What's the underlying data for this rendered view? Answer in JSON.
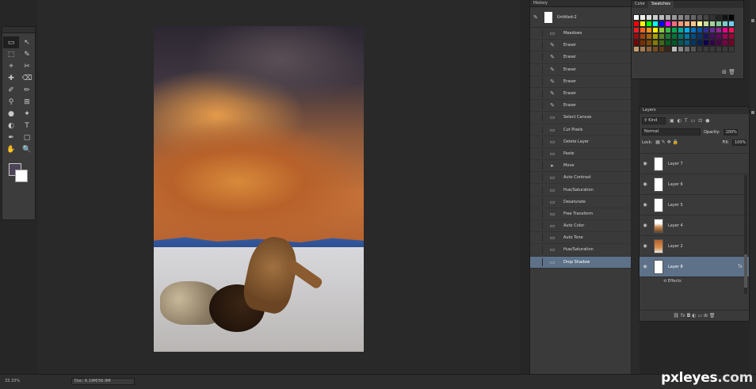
{
  "tools": {
    "items": [
      "▭",
      "↖",
      "⬚",
      "✎",
      "⌖",
      "✂",
      "✚",
      "⌫",
      "✐",
      "✏",
      "⚲",
      "⊞",
      "●",
      "✦",
      "◐",
      "T",
      "✒",
      "▢",
      "✋",
      "🔍"
    ],
    "fg_color": "#4d4458",
    "bg_color": "#ffffff"
  },
  "history": {
    "tab": "History",
    "snapshot": "Untitled-2",
    "items": [
      {
        "label": "Meadows",
        "icon": ""
      },
      {
        "label": "Eraser",
        "icon": "✎"
      },
      {
        "label": "Eraser",
        "icon": "✎"
      },
      {
        "label": "Eraser",
        "icon": "✎"
      },
      {
        "label": "Eraser",
        "icon": "✎"
      },
      {
        "label": "Eraser",
        "icon": "✎"
      },
      {
        "label": "Eraser",
        "icon": "✎"
      },
      {
        "label": "Select Canvas",
        "icon": ""
      },
      {
        "label": "Cut Pixels",
        "icon": ""
      },
      {
        "label": "Delete Layer",
        "icon": ""
      },
      {
        "label": "Paste",
        "icon": ""
      },
      {
        "label": "Move",
        "icon": "▸"
      },
      {
        "label": "Auto Contrast",
        "icon": ""
      },
      {
        "label": "Hue/Saturation",
        "icon": ""
      },
      {
        "label": "Desaturate",
        "icon": ""
      },
      {
        "label": "Free Transform",
        "icon": ""
      },
      {
        "label": "Auto Color",
        "icon": ""
      },
      {
        "label": "Auto Tone",
        "icon": ""
      },
      {
        "label": "Hue/Saturation",
        "icon": ""
      },
      {
        "label": "Drop Shadow",
        "icon": ""
      }
    ]
  },
  "swatches": {
    "tabs": [
      "Color",
      "Swatches"
    ],
    "colors": [
      "#ffffff",
      "#eeeeee",
      "#dddddd",
      "#cccccc",
      "#bbbbbb",
      "#aaaaaa",
      "#999999",
      "#888888",
      "#777777",
      "#666666",
      "#555555",
      "#444444",
      "#333333",
      "#222222",
      "#111111",
      "#000000",
      "#ff0000",
      "#ffff00",
      "#00ff00",
      "#00ffff",
      "#0000ff",
      "#ff00ff",
      "#f26d7d",
      "#f7977a",
      "#fbad82",
      "#fdc68c",
      "#fff79a",
      "#c4df9b",
      "#a3d39c",
      "#82ca9d",
      "#7bcdc8",
      "#6ecff6",
      "#ed1c24",
      "#f26522",
      "#f7941d",
      "#fff200",
      "#8dc63f",
      "#39b54a",
      "#00a651",
      "#00a99d",
      "#00aeef",
      "#0072bc",
      "#0054a6",
      "#2e3192",
      "#662d91",
      "#92278f",
      "#ec008c",
      "#ed145b",
      "#9e0b0f",
      "#a0410d",
      "#a36209",
      "#aba000",
      "#598527",
      "#1a7b30",
      "#007236",
      "#00746b",
      "#0076a3",
      "#004b80",
      "#003471",
      "#1b1464",
      "#440e62",
      "#630460",
      "#9e005d",
      "#9e0039",
      "#790000",
      "#7b2e00",
      "#7d4900",
      "#827b00",
      "#406618",
      "#005e20",
      "#005826",
      "#005952",
      "#005b7f",
      "#003663",
      "#002157",
      "#0d004c",
      "#32004b",
      "#4b0049",
      "#7b0046",
      "#7a0026",
      "#c69c6d",
      "#a67c52",
      "#8c6239",
      "#754c24",
      "#603913",
      "#3c2415",
      "#bcbcbc",
      "#898989",
      "#707070",
      "#555555",
      "#3a3a3a",
      "#3a3a3a",
      "#3a3a3a",
      "#3a3a3a",
      "#3a3a3a",
      "#3a3a3a"
    ],
    "footer": "⊞  🗑"
  },
  "layers": {
    "tab": "Layers",
    "filter": "⚲ Kind",
    "filter_icons": [
      "▣",
      "◐",
      "T",
      "▭",
      "⊡",
      "●"
    ],
    "blend_mode": "Normal",
    "opacity_label": "Opacity:",
    "opacity": "100%",
    "lock_label": "Lock:",
    "lock_icons": "▦ ✎ ✥ 🔒",
    "fill_label": "Fill:",
    "fill": "100%",
    "rows": [
      {
        "name": "Layer 7",
        "thumb": "white",
        "fx": ""
      },
      {
        "name": "Layer 6",
        "thumb": "white",
        "fx": ""
      },
      {
        "name": "Layer 5",
        "thumb": "white",
        "fx": ""
      },
      {
        "name": "Layer 4",
        "thumb": "img2",
        "fx": ""
      },
      {
        "name": "Layer 2",
        "thumb": "img",
        "fx": ""
      },
      {
        "name": "Layer 8",
        "thumb": "white",
        "fx": "fx"
      }
    ],
    "effects": "⟲ Effects",
    "footer": "⛓  fx  ◘  ◐  ▭  ⊞  🗑"
  },
  "status": {
    "zoom": "33.33%",
    "doc": "Doc: 6.19M/56.9M"
  },
  "watermark": {
    "brand": "pxleyes",
    "dot": ".com"
  }
}
